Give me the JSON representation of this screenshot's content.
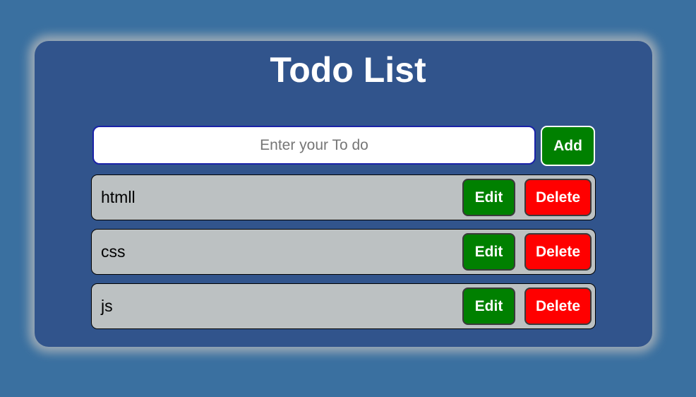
{
  "app": {
    "title": "Todo List"
  },
  "form": {
    "placeholder": "Enter your To do",
    "value": "",
    "add_label": "Add"
  },
  "todos": [
    {
      "text": "htmll",
      "edit_label": "Edit",
      "delete_label": "Delete"
    },
    {
      "text": "css",
      "edit_label": "Edit",
      "delete_label": "Delete"
    },
    {
      "text": "js",
      "edit_label": "Edit",
      "delete_label": "Delete"
    }
  ],
  "colors": {
    "page_background": "#3a70a0",
    "card_background": "#31548c",
    "item_background": "#bcc1c2",
    "edit_button": "#008000",
    "delete_button": "#ff0000",
    "add_button": "#008000"
  }
}
